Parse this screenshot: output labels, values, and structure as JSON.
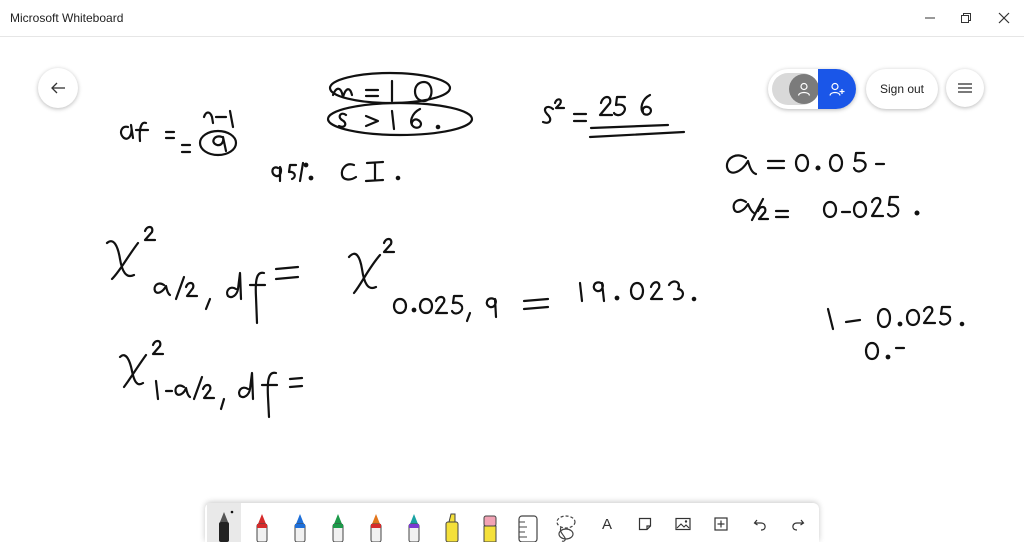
{
  "window": {
    "title": "Microsoft Whiteboard",
    "minimize_icon": "minimize-icon",
    "restore_icon": "restore-icon",
    "close_icon": "close-icon"
  },
  "header": {
    "back_icon": "arrow-left-icon",
    "sign_out_label": "Sign out",
    "menu_icon": "hamburger-menu-icon",
    "user_icon": "person-icon",
    "invite_icon": "add-person-icon"
  },
  "colors": {
    "accent_blue": "#1a56e8",
    "ink": "#111111",
    "pen_red": "#d62b2b",
    "pen_blue": "#1e6fd9",
    "pen_green": "#1d9a4a",
    "pen_orange": "#e2761b",
    "pen_teal": "#1aa3a3",
    "highlighter_yellow": "#f4e03a",
    "eraser_pink": "#f2a3b5"
  },
  "toolbar": {
    "tools": [
      {
        "name": "black-pen",
        "icon": "pen-icon",
        "selected": true
      },
      {
        "name": "red-pen",
        "icon": "pen-icon"
      },
      {
        "name": "blue-pen",
        "icon": "pen-icon"
      },
      {
        "name": "green-pen",
        "icon": "pen-icon"
      },
      {
        "name": "orange-pen",
        "icon": "pen-icon"
      },
      {
        "name": "teal-pen",
        "icon": "pen-icon"
      },
      {
        "name": "highlighter",
        "icon": "highlighter-icon"
      },
      {
        "name": "eraser",
        "icon": "eraser-icon"
      },
      {
        "name": "ruler",
        "icon": "ruler-icon"
      },
      {
        "name": "lasso",
        "icon": "lasso-icon"
      }
    ],
    "text_tool_glyph": "A",
    "actions": [
      {
        "name": "text",
        "icon": "text-icon"
      },
      {
        "name": "note",
        "icon": "sticky-note-icon"
      },
      {
        "name": "image",
        "icon": "image-icon"
      },
      {
        "name": "insert",
        "icon": "add-box-icon"
      },
      {
        "name": "undo",
        "icon": "undo-icon"
      },
      {
        "name": "redo",
        "icon": "redo-icon"
      }
    ]
  }
}
